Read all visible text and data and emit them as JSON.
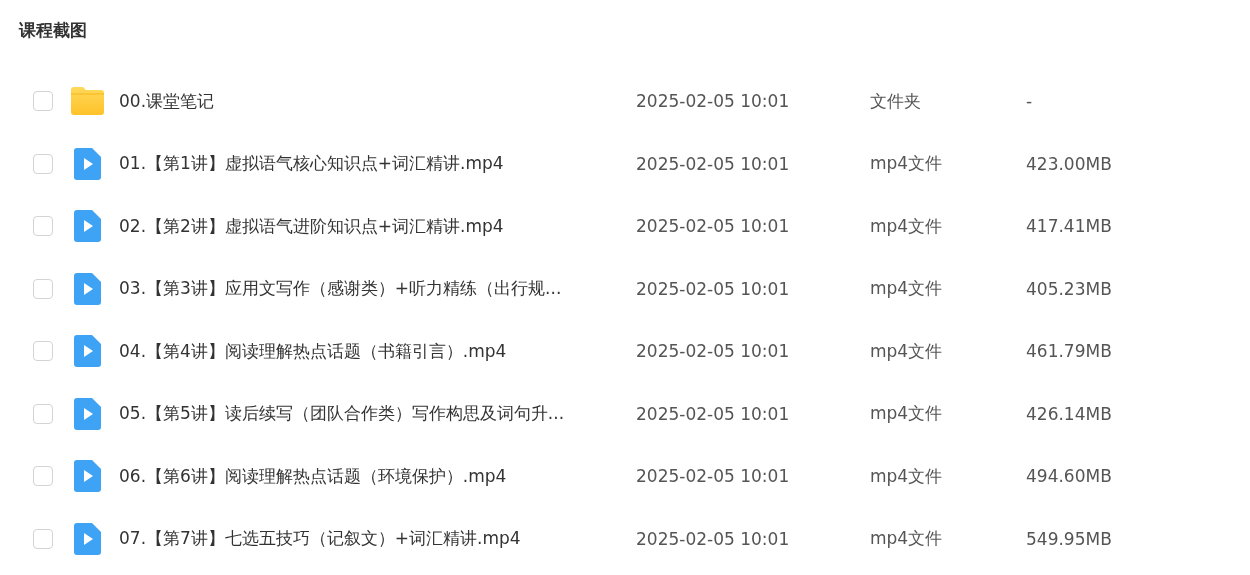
{
  "title": "课程截图",
  "files": [
    {
      "kind": "folder",
      "checked": false,
      "name": "00.课堂笔记",
      "date": "2025-02-05 10:01",
      "type": "文件夹",
      "size": "-"
    },
    {
      "kind": "video",
      "checked": false,
      "name": "01.【第1讲】虚拟语气核心知识点+词汇精讲.mp4",
      "date": "2025-02-05 10:01",
      "type": "mp4文件",
      "size": "423.00MB"
    },
    {
      "kind": "video",
      "checked": false,
      "name": "02.【第2讲】虚拟语气进阶知识点+词汇精讲.mp4",
      "date": "2025-02-05 10:01",
      "type": "mp4文件",
      "size": "417.41MB"
    },
    {
      "kind": "video",
      "checked": false,
      "name": "03.【第3讲】应用文写作（感谢类）+听力精练（出行规...",
      "date": "2025-02-05 10:01",
      "type": "mp4文件",
      "size": "405.23MB"
    },
    {
      "kind": "video",
      "checked": false,
      "name": "04.【第4讲】阅读理解热点话题（书籍引言）.mp4",
      "date": "2025-02-05 10:01",
      "type": "mp4文件",
      "size": "461.79MB"
    },
    {
      "kind": "video",
      "checked": false,
      "name": "05.【第5讲】读后续写（团队合作类）写作构思及词句升...",
      "date": "2025-02-05 10:01",
      "type": "mp4文件",
      "size": "426.14MB"
    },
    {
      "kind": "video",
      "checked": false,
      "name": "06.【第6讲】阅读理解热点话题（环境保护）.mp4",
      "date": "2025-02-05 10:01",
      "type": "mp4文件",
      "size": "494.60MB"
    },
    {
      "kind": "video",
      "checked": false,
      "name": "07.【第7讲】七选五技巧（记叙文）+词汇精讲.mp4",
      "date": "2025-02-05 10:01",
      "type": "mp4文件",
      "size": "549.95MB"
    }
  ]
}
